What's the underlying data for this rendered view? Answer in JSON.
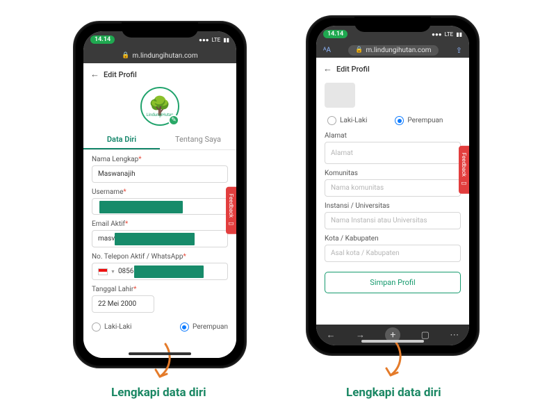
{
  "statusbar": {
    "time": "14.14",
    "net": "LTE"
  },
  "url": "m.lindungihutan.com",
  "phone1": {
    "page_title": "Edit Profil",
    "logo_caption": "LindungiHutan",
    "tabs": {
      "data_diri": "Data Diri",
      "tentang_saya": "Tentang Saya"
    },
    "fields": {
      "nama_label": "Nama Lengkap",
      "nama_value": "Maswanajih",
      "username_label": "Username",
      "email_label": "Email Aktif",
      "email_value_prefix": "masv",
      "phone_label": "No. Telepon Aktif / WhatsApp",
      "phone_value_prefix": "0856",
      "dob_label": "Tanggal Lahir",
      "dob_value": "22 Mei 2000"
    },
    "gender": {
      "laki": "Laki-Laki",
      "perempuan": "Perempuan"
    },
    "feedback": "Feedback"
  },
  "phone2": {
    "page_title": "Edit Profil",
    "gender": {
      "laki": "Laki-Laki",
      "perempuan": "Perempuan"
    },
    "fields": {
      "alamat_label": "Alamat",
      "alamat_placeholder": "Alamat",
      "komunitas_label": "Komunitas",
      "komunitas_placeholder": "Nama komunitas",
      "instansi_label": "Instansi / Universitas",
      "instansi_placeholder": "Nama Instansi atau Universitas",
      "kota_label": "Kota / Kabupaten",
      "kota_placeholder": "Asal kota / Kabupaten"
    },
    "save": "Simpan Profil",
    "feedback": "Feedback"
  },
  "callout": "Lengkapi data diri"
}
